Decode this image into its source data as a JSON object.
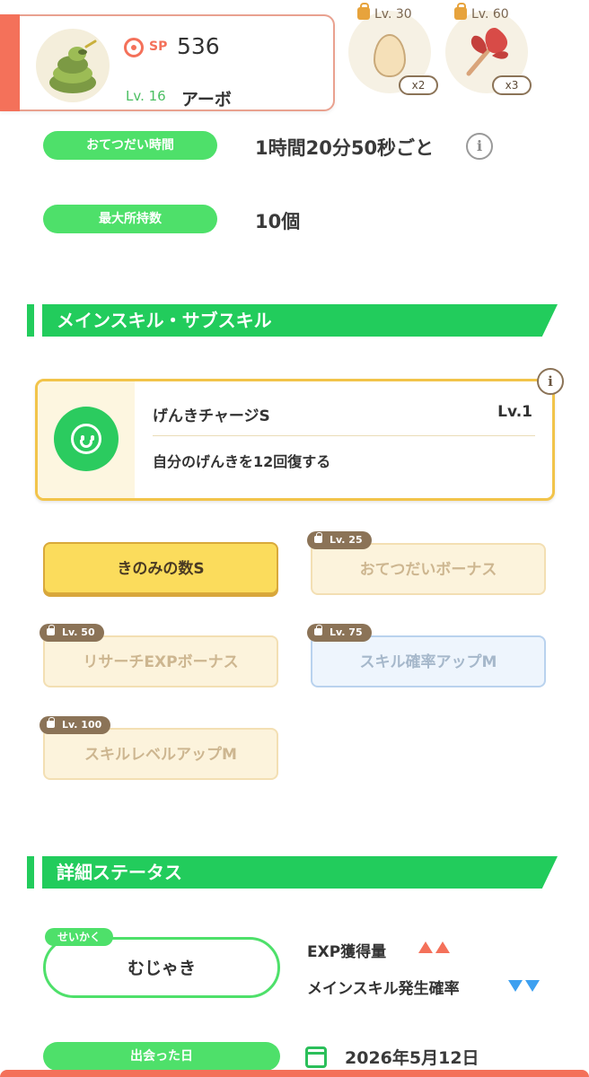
{
  "pokemon": {
    "sp_label": "SP",
    "sp_value": "536",
    "level_label": "Lv. 16",
    "name": "アーボ"
  },
  "unlocks": [
    {
      "level": "Lv. 30",
      "count": "x2",
      "icon": "egg-icon"
    },
    {
      "level": "Lv. 60",
      "count": "x3",
      "icon": "leaf-icon"
    }
  ],
  "info_rows": {
    "help_time": {
      "label": "おてつだい時間",
      "value": "1時間20分50秒ごと",
      "info": "i"
    },
    "max_carry": {
      "label": "最大所持数",
      "value": "10個"
    }
  },
  "sections": {
    "skills": "メインスキル・サブスキル",
    "details": "詳細ステータス"
  },
  "main_skill": {
    "name": "げんきチャージS",
    "level": "Lv.1",
    "description": "自分のげんきを12回復する",
    "info": "i"
  },
  "sub_skills": [
    {
      "label": "きのみの数S",
      "locked": false,
      "lock_level": ""
    },
    {
      "label": "おてつだいボーナス",
      "locked": true,
      "lock_level": "Lv. 25"
    },
    {
      "label": "リサーチEXPボーナス",
      "locked": true,
      "lock_level": "Lv. 50"
    },
    {
      "label": "スキル確率アップM",
      "locked": true,
      "lock_level": "Lv. 75"
    },
    {
      "label": "スキルレベルアップM",
      "locked": true,
      "lock_level": "Lv. 100"
    }
  ],
  "nature": {
    "tag": "せいかく",
    "value": "むじゃき",
    "effects": [
      {
        "label": "EXP獲得量",
        "direction": "up",
        "color": "#f4715a"
      },
      {
        "label": "メインスキル発生確率",
        "direction": "down",
        "color": "#3da0f0"
      }
    ]
  },
  "met_date": {
    "label": "出会った日",
    "value": "2026年5月12日"
  },
  "colors": {
    "accent_green": "#22cc5c",
    "pill_green": "#4ee06a",
    "accent_red": "#f4715a",
    "gold_border": "#f2c44a"
  }
}
